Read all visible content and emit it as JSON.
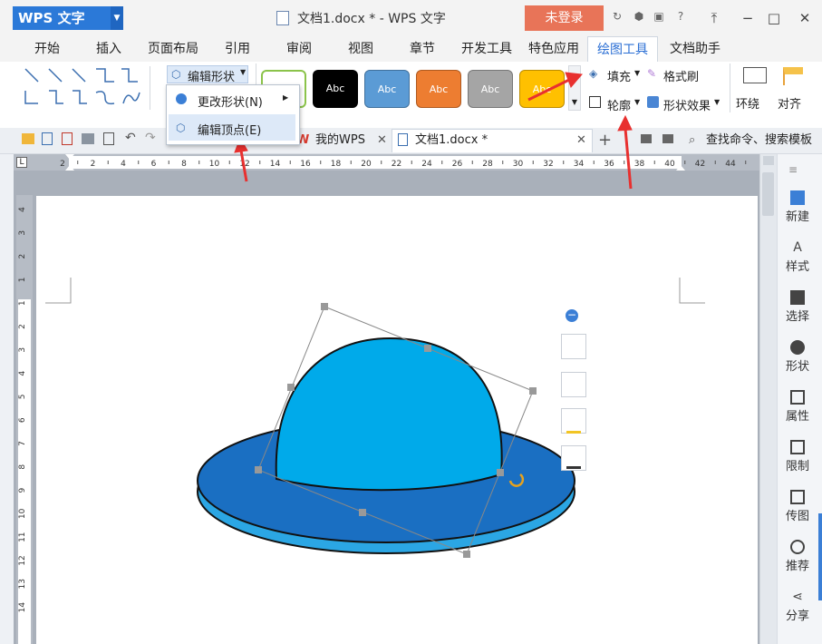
{
  "app": {
    "brand": "WPS 文字",
    "title": "文档1.docx * - WPS 文字",
    "login": "未登录"
  },
  "menu_tabs": [
    "开始",
    "插入",
    "页面布局",
    "引用",
    "审阅",
    "视图",
    "章节",
    "开发工具",
    "特色应用",
    "绘图工具",
    "文档助手"
  ],
  "active_tab": "绘图工具",
  "ribbon": {
    "edit_shape": "编辑形状",
    "change_shape": "更改形状(N)",
    "edit_vertices": "编辑顶点(E)",
    "style_swatch_text": "Abc",
    "fill": "填充",
    "format_painter": "格式刷",
    "outline": "轮廓",
    "shape_effects": "形状效果",
    "wrap": "环绕",
    "align": "对齐"
  },
  "doc_tabs": {
    "my_wps": "我的WPS",
    "document": "文档1.docx *",
    "search_placeholder": "查找命令、搜索模板"
  },
  "ruler": {
    "h_ticks": [
      "2",
      "2",
      "4",
      "6",
      "8",
      "10",
      "12",
      "14",
      "16",
      "18",
      "20",
      "22",
      "24",
      "26",
      "28",
      "30",
      "32",
      "34",
      "36",
      "38",
      "40",
      "42",
      "44"
    ],
    "v_ticks": [
      "4",
      "3",
      "2",
      "1",
      "1",
      "2",
      "3",
      "4",
      "5",
      "6",
      "7",
      "8",
      "9",
      "10",
      "11",
      "12",
      "13",
      "14"
    ]
  },
  "sidebar": [
    "新建",
    "样式",
    "选择",
    "形状",
    "属性",
    "限制",
    "传图",
    "推荐",
    "分享"
  ],
  "colors": {
    "accent": "#2b79d8",
    "login_bg": "#e87458",
    "hat_top": "#00aaea",
    "hat_brim": "#1a6fc2",
    "hat_brim_edge": "#2ba6e4",
    "arrow": "#e8302f",
    "swatches": [
      "#ffffff",
      "#000000",
      "#5b9bd5",
      "#ed7d31",
      "#a5a5a5",
      "#ffc000"
    ]
  }
}
